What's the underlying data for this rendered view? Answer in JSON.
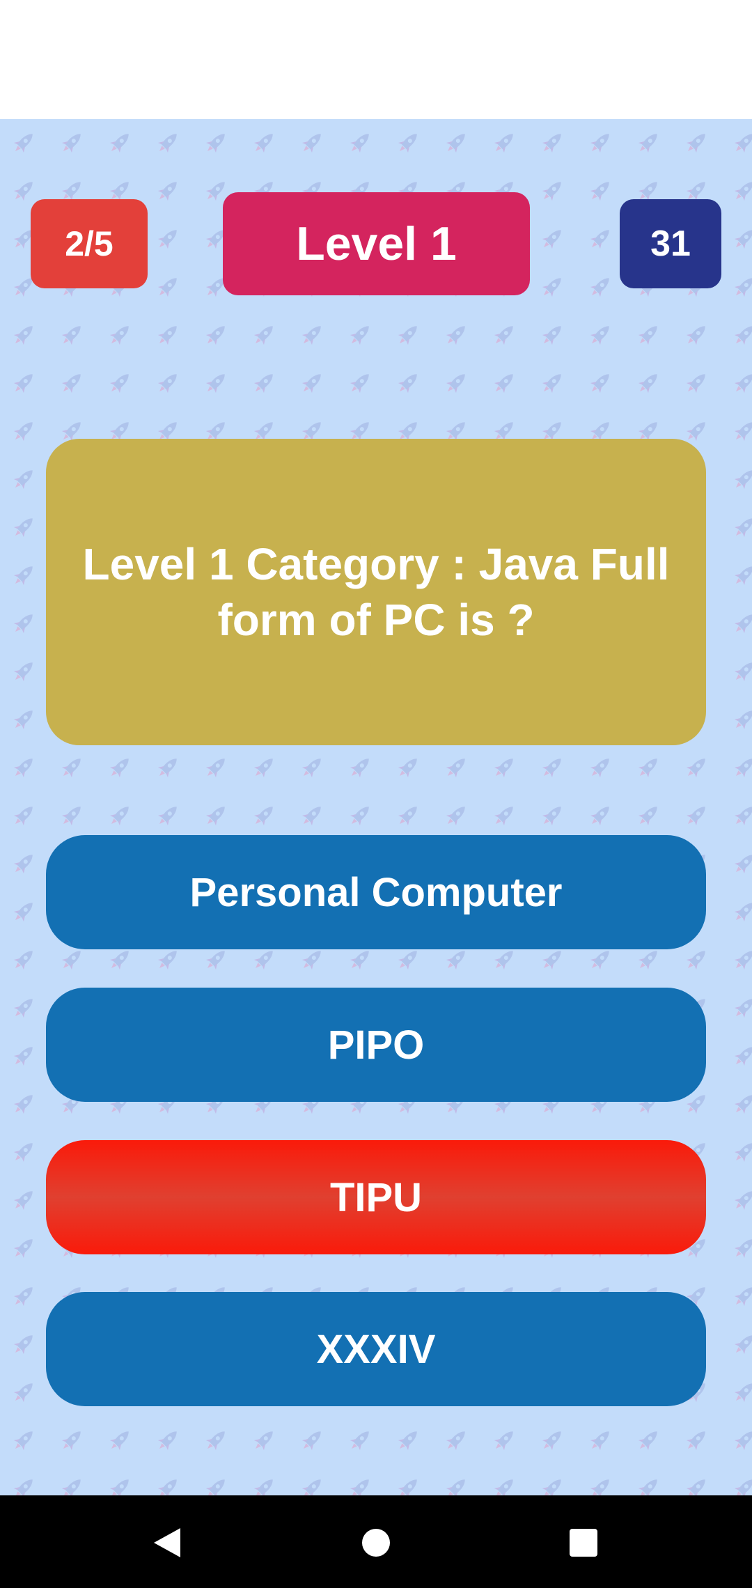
{
  "header": {
    "progress": "2/5",
    "level": "Level 1",
    "timer": "31"
  },
  "question": {
    "text": "Level 1 Category : Java Full form of PC is ?"
  },
  "answers": [
    {
      "label": "Personal Computer",
      "state": "default"
    },
    {
      "label": "PIPO",
      "state": "default"
    },
    {
      "label": "TIPU",
      "state": "wrong"
    },
    {
      "label": "XXXIV",
      "state": "default"
    }
  ],
  "nav": {
    "back_icon": "back-triangle-icon",
    "home_icon": "home-circle-icon",
    "recents_icon": "recents-square-icon"
  },
  "background_icon": "rocket-icon",
  "colors": {
    "background": "#c3dcfa",
    "progress_badge": "#e3403a",
    "level_badge": "#d4245e",
    "timer_badge": "#27348b",
    "question_card": "#c7b14e",
    "answer_default": "#1370b3",
    "answer_wrong_top": "#fa1a0a",
    "answer_wrong_mid": "#e04030",
    "pattern_rocket": "#b0a0d8"
  }
}
